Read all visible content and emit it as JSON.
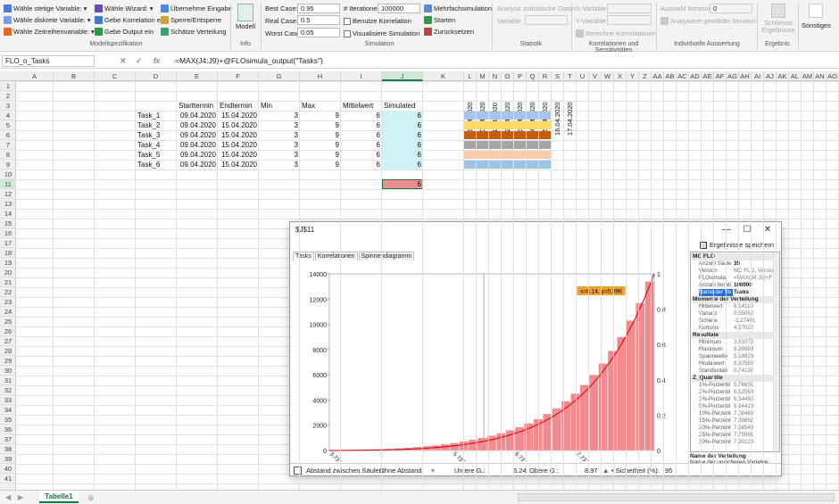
{
  "ribbon": {
    "variables": [
      "Wähle stetige Variable:",
      "Wähle diskrete Variable:",
      "Wähle Zeitreihenvariable:"
    ],
    "wizard": [
      "Wähle Wizard:",
      "Gebe Korrelation ein",
      "Gebe Output ein"
    ],
    "model_actions": [
      "Übernehme Eingabe",
      "Sperre/Entsperre",
      "Schätze Verteilung"
    ],
    "group_modellspezifikation": "Modellspezifikation",
    "model_button": "Modell",
    "group_info": "Info",
    "best_case_label": "Best Case:",
    "best_case_value": "0.95",
    "real_case_label": "Real Case:",
    "real_case_value": "0.5",
    "worst_case_label": "Worst Case:",
    "worst_case_value": "0.05",
    "iterations_label": "# Iterationen:",
    "iterations_value": "100000",
    "benutze_korrelation": "Benutze Korrelation",
    "visualisiere_simulation": "Visualisiere Simulation",
    "mehrfach": "Mehrfachsimulation",
    "starten": "Starten",
    "zuruecksetzen": "Zurücksetzen",
    "group_simulation": "Simulation",
    "analyse": "Analyse statistische Daten",
    "variable_label": "Variable",
    "group_statistik": "Statistik",
    "x_variable": "X-Variable",
    "y_variable": "Y-Variable",
    "berechne": "Berechne Korrelationen",
    "group_korrelationen": "Korrelationen und Sensitivitäten",
    "auswahl_iteration": "Auswahl Iteration:",
    "auswahl_iteration_value": "0",
    "analysiere": "Analysiere gewählte Iteration",
    "group_individuelle": "Individuelle Auswertung",
    "schliesse": "Schliesse Ergebnisse",
    "group_ergebnis": "Ergebnis",
    "sonstiges": "Sonstiges"
  },
  "formula_bar": {
    "name_box": "FLO_o_Tasks",
    "cancel": "✕",
    "confirm": "✓",
    "fx": "fx",
    "formula": "=MAX(J4:J9)+@FLOsimula_output(\"Tasks\")"
  },
  "columns": [
    "A",
    "B",
    "C",
    "D",
    "E",
    "F",
    "G",
    "H",
    "I",
    "J",
    "K",
    "L",
    "M",
    "N",
    "O",
    "P",
    "Q",
    "R",
    "S",
    "T",
    "U",
    "V",
    "W",
    "X",
    "Y",
    "Z",
    "AA",
    "AB",
    "AC",
    "AD",
    "AE",
    "AF",
    "AG",
    "AH",
    "AI",
    "AJ",
    "AK",
    "AL",
    "AM",
    "AN",
    "AO"
  ],
  "rows": [
    "1",
    "2",
    "3",
    "4",
    "5",
    "6",
    "7",
    "8",
    "9",
    "10",
    "11",
    "12",
    "13",
    "14",
    "15",
    "16",
    "17",
    "18",
    "19",
    "20",
    "21",
    "22",
    "23",
    "24",
    "25",
    "26",
    "27",
    "28",
    "29",
    "30",
    "31",
    "32",
    "33",
    "34",
    "35",
    "36",
    "37",
    "38",
    "39",
    "40",
    "41"
  ],
  "sheet": {
    "headers": [
      "Starttermin",
      "Endtermin",
      "Min",
      "Max",
      "Mittelwert",
      "Simulated"
    ],
    "tasks": [
      {
        "name": "Task_1",
        "start": "09.04.2020",
        "end": "15.04.2020",
        "min": "3",
        "max": "9",
        "mean": "6",
        "sim": "6"
      },
      {
        "name": "Task_2",
        "start": "09.04.2020",
        "end": "15.04.2020",
        "min": "3",
        "max": "9",
        "mean": "6",
        "sim": "6"
      },
      {
        "name": "Task_3",
        "start": "09.04.2020",
        "end": "15.04.2020",
        "min": "3",
        "max": "9",
        "mean": "6",
        "sim": "6"
      },
      {
        "name": "Task_4",
        "start": "09.04.2020",
        "end": "15.04.2020",
        "min": "3",
        "max": "9",
        "mean": "6",
        "sim": "6"
      },
      {
        "name": "Task_5",
        "start": "09.04.2020",
        "end": "15.04.2020",
        "min": "3",
        "max": "9",
        "mean": "6",
        "sim": "6"
      },
      {
        "name": "Task_6",
        "start": "09.04.2020",
        "end": "15.04.2020",
        "min": "3",
        "max": "9",
        "mean": "6",
        "sim": "6"
      }
    ],
    "total": "6",
    "gantt_dates": [
      "09.04.2020",
      "10.04.2020",
      "11.04.2020",
      "12.04.2020",
      "13.04.2020",
      "14.04.2020",
      "15.04.2020",
      "16.04.2020",
      "17.04.2020"
    ],
    "gantt_colors": [
      "#a9c4eb",
      "#ffd966",
      "#c55a11",
      "#a5a5a5",
      "#f8cbad",
      "#9dc3e6"
    ]
  },
  "tabs": {
    "nav_left": "◀",
    "nav_right": "▶",
    "sheet": "Tabelle1",
    "add": "⊕"
  },
  "dialog": {
    "title": "$J$11",
    "minimize": "—",
    "maximize": "☐",
    "close": "✕",
    "save_label": "Ergebnisse speichern",
    "tabs": [
      "Tasks",
      "Korrelationen",
      "Spinnendiagramm"
    ],
    "bottom": {
      "abstand_label": "Abstand zwischen Säulen:",
      "abstand_value": "Ohne Abstand",
      "untere_label": "Untere G.:",
      "untere_value": "6.24",
      "obere_label": "Obere G.:",
      "obere_value": "8.97",
      "sicherheit_label": "• Sicherheit (%):",
      "sicherheit_value": "95"
    },
    "properties": {
      "sections": [
        {
          "title": "MC FLO",
          "rows": [
            [
              "Anzahl Säule",
              "35"
            ],
            [
              "Version",
              "MC FLO, Versio"
            ],
            [
              "FLOsimula",
              "=MAX(J4:J9)+F"
            ],
            [
              "Anzahl Iterati",
              "100000"
            ],
            [
              "Name der Ve",
              "Tasks"
            ]
          ]
        },
        {
          "title": "Momente der Verteilung",
          "rows": [
            [
              "Mittelwert",
              "6.14110"
            ],
            [
              "Varianz",
              "0.55052"
            ],
            [
              "Schiefe",
              "-1.27401"
            ],
            [
              "Kurtosis",
              "4.57022"
            ]
          ]
        },
        {
          "title": "Resultate",
          "rows": [
            [
              "Minimum",
              "3.81076"
            ],
            [
              "Maximum",
              "8.99999"
            ],
            [
              "Spannweite",
              "5.18924"
            ],
            [
              "Modalwert",
              "8.92566"
            ],
            [
              "Standardab",
              "0.74197"
            ]
          ]
        },
        {
          "title": "Z_Quantile",
          "rows": [
            [
              "1%-Perzentil",
              "5.78651"
            ],
            [
              "2%-Perzentil",
              "6.12564"
            ],
            [
              "3%-Perzentil",
              "6.34460"
            ],
            [
              "5%-Perzentil",
              "6.64414"
            ],
            [
              "10%-Perzent",
              "7.08466"
            ],
            [
              "15%-Perzent",
              "7.38867"
            ],
            [
              "20%-Perzent",
              "7.58543"
            ],
            [
              "25%-Perzent",
              "7.75991"
            ],
            [
              "30%-Perzent",
              "7.90129"
            ]
          ]
        }
      ],
      "desc_title": "Name der Verteilung",
      "desc_text": "Name der unsicheren Variable"
    }
  },
  "chart_data": {
    "type": "bar",
    "bin_start": 3.737,
    "bin_width": 0.1504,
    "values": [
      30,
      40,
      50,
      60,
      80,
      100,
      130,
      170,
      220,
      280,
      350,
      420,
      500,
      600,
      720,
      860,
      1000,
      1180,
      1380,
      1600,
      1850,
      2150,
      2500,
      2900,
      3350,
      3900,
      4500,
      5200,
      6000,
      6900,
      7900,
      9000,
      10300,
      11700,
      13400
    ],
    "cumulative_series": true,
    "ylim": [
      0,
      14000
    ],
    "y_ticks": [
      "0",
      "2000",
      "4000",
      "6000",
      "8000",
      "10000",
      "12000",
      "14000"
    ],
    "y2_ticks": [
      "0",
      "0.2",
      "0.4",
      "0.6",
      "0.8",
      "1"
    ],
    "x_ticks": [
      "3.737",
      "5.737",
      "6.737",
      "7.737"
    ],
    "lower_bound": 6.24,
    "upper_bound": 8.97,
    "marker_x": 8.14,
    "annotation": "x=8.14, y=0.396",
    "bar_color": "#f28b90",
    "line_color": "#cc0000"
  }
}
